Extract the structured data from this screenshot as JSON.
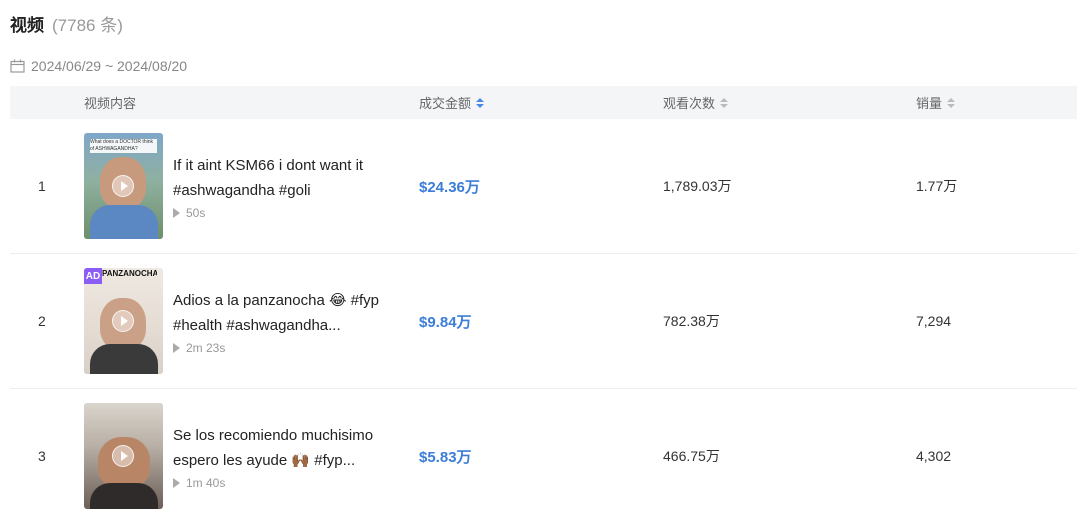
{
  "header": {
    "title": "视频",
    "count": "(7786 条)"
  },
  "date_range": "2024/06/29 ~ 2024/08/20",
  "table": {
    "columns": {
      "content": "视频内容",
      "gmv": "成交金额",
      "views": "观看次数",
      "sales": "销量"
    },
    "rows": [
      {
        "rank": "1",
        "line1": "If it aint KSM66 i dont want it",
        "line2": "#ashwagandha #goli",
        "duration": "50s",
        "gmv": "$24.36万",
        "views": "1,789.03万",
        "sales": "1.77万"
      },
      {
        "rank": "2",
        "line1": "Adios a la panzanocha 😂 #fyp",
        "line2": "#health #ashwagandha...",
        "duration": "2m 23s",
        "gmv": "$9.84万",
        "views": "782.38万",
        "sales": "7,294",
        "badge": "AD",
        "thumb_caption": "PANZANOCHA..."
      },
      {
        "rank": "3",
        "line1": "Se los recomiendo muchisimo",
        "line2": "espero les ayude 🙌🏾 #fyp...",
        "duration": "1m 40s",
        "gmv": "$5.83万",
        "views": "466.75万",
        "sales": "4,302"
      }
    ]
  },
  "thumbnail_1_caption": "What does a DOCTOR think of ASHWAGANDHA?",
  "colors": {
    "accent": "#3b7dd8",
    "header_bg": "#f4f5f7",
    "ad_badge": "#8b5cf6"
  }
}
